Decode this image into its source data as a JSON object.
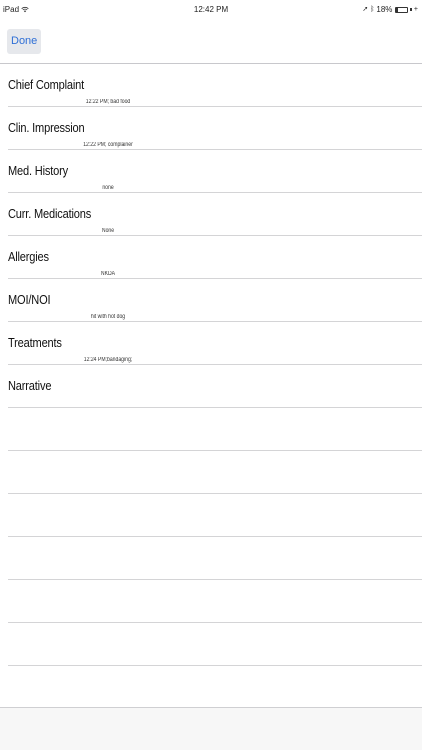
{
  "status_bar": {
    "device": "iPad",
    "time": "12:42 PM",
    "battery": "18%",
    "battery_level": 0.18
  },
  "nav": {
    "done_label": "Done"
  },
  "form": {
    "rows": [
      {
        "label": "Chief Complaint",
        "value": "12:22 PM; bad food"
      },
      {
        "label": "Clin. Impression",
        "value": "12:22 PM; complainer"
      },
      {
        "label": "Med. History",
        "value": "none"
      },
      {
        "label": "Curr. Medications",
        "value": "None"
      },
      {
        "label": "Allergies",
        "value": "NKDA"
      },
      {
        "label": "MOI/NOI",
        "value": "hit with hot dog"
      },
      {
        "label": "Treatments",
        "value": "12:24 PM;bandaging;"
      },
      {
        "label": "Narrative",
        "value": ""
      },
      {
        "label": "",
        "value": ""
      },
      {
        "label": "",
        "value": ""
      },
      {
        "label": "",
        "value": ""
      },
      {
        "label": "",
        "value": ""
      },
      {
        "label": "",
        "value": ""
      },
      {
        "label": "",
        "value": ""
      },
      {
        "label": "",
        "value": ""
      }
    ]
  },
  "colors": {
    "accent": "#2f6fd6",
    "separator": "#d4d4d6",
    "toolbar": "#f7f7f7"
  }
}
